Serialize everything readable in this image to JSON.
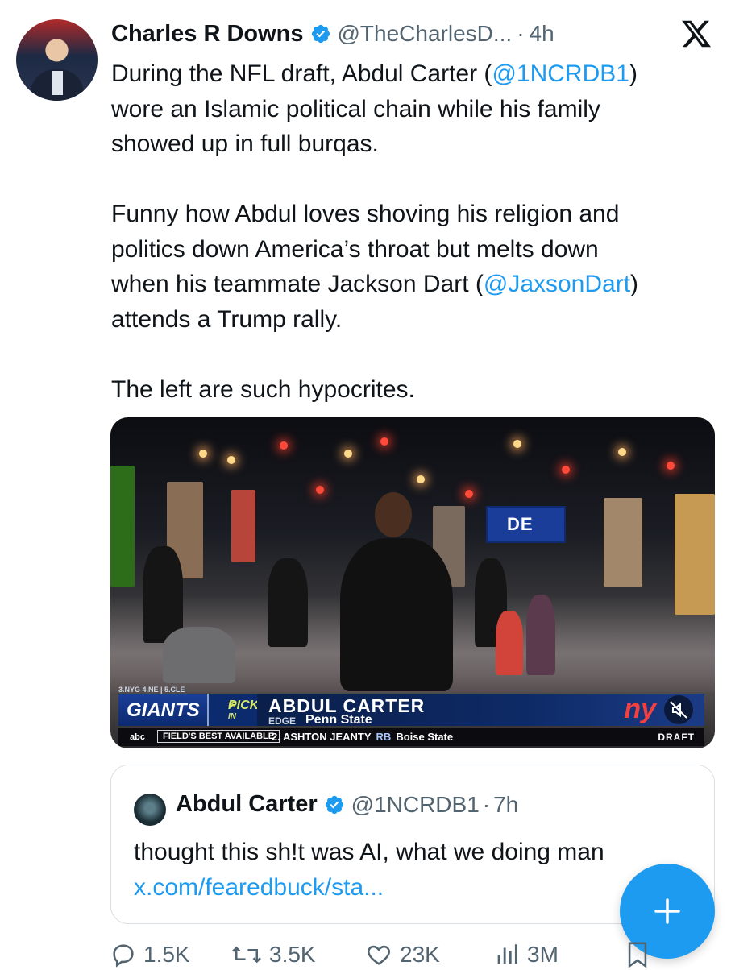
{
  "post": {
    "author_name": "Charles R Downs",
    "author_handle": "@TheCharlesD...",
    "separator": "·",
    "time": "4h",
    "body": [
      [
        "During the NFL draft, Abdul Carter (",
        "@1NCRDB1",
        ")"
      ],
      [
        "wore an Islamic political chain while his family"
      ],
      [
        "showed up in full burqas."
      ],
      [],
      [
        "Funny how Abdul loves shoving his religion and"
      ],
      [
        "politics down America’s throat but melts down"
      ],
      [
        "when his teammate Jackson Dart (",
        "@JaxsonDart",
        ")"
      ],
      [
        "attends a Trump rally."
      ],
      [],
      [
        "The left are such hypocrites."
      ]
    ]
  },
  "media": {
    "screen_text": "DE",
    "lower_third": {
      "standings": "3.NYG   4.NE  |  5.CLE",
      "team": "GIANTS",
      "pick_line1": "PICK",
      "pick_line2": "IS IN",
      "player_name": "ABDUL CARTER",
      "position": "EDGE",
      "school": "Penn State",
      "team_logo": "ny",
      "network": "abc",
      "best_available_label": "FIELD'S BEST AVAILABLE",
      "ticker_rank": "2. ASHTON JEANTY",
      "ticker_pos": "RB",
      "ticker_school": "Boise State",
      "draft_label": "DRAFT"
    },
    "mute_icon": "speaker-muted-icon"
  },
  "quoted_post": {
    "author_name": "Abdul Carter",
    "author_handle": "@1NCRDB1",
    "separator": "·",
    "time": "7h",
    "text": "thought this sh!t was AI, what we doing man",
    "link": "x.com/fearedbuck/sta..."
  },
  "actions": {
    "replies": "1.5K",
    "reposts": "3.5K",
    "likes": "23K",
    "views": "3M"
  },
  "colors": {
    "accent": "#1d9bf0",
    "text_primary": "#0f1419",
    "text_secondary": "#536471",
    "border": "#d9dfe4"
  }
}
